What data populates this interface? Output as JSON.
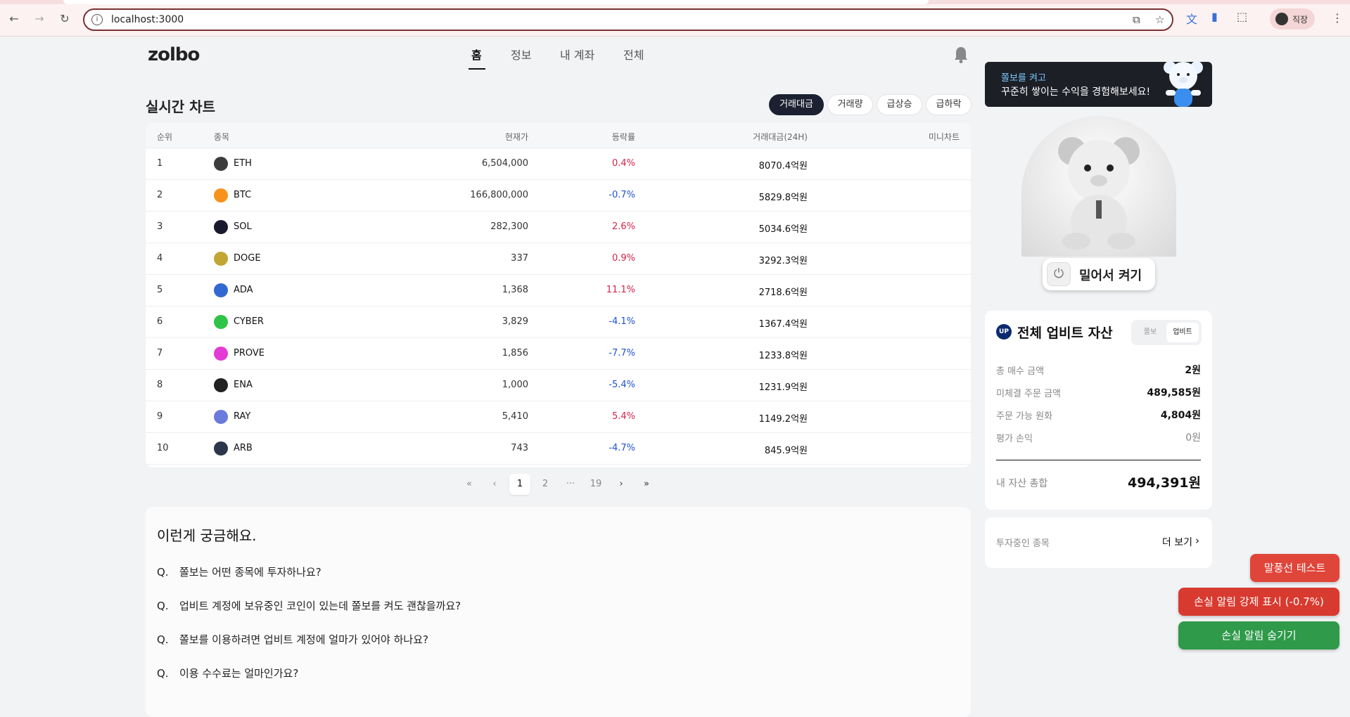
{
  "browser": {
    "url": "localhost:3000",
    "profile_name": "직장"
  },
  "app": {
    "logo": "zolbo",
    "nav": [
      "홈",
      "정보",
      "내 계좌",
      "전체"
    ]
  },
  "chart_section": {
    "title": "실시간 차트",
    "filters": [
      "거래대금",
      "거래량",
      "급상승",
      "급하락"
    ],
    "active_filter": "거래대금",
    "columns": [
      "순위",
      "종목",
      "현재가",
      "등락률",
      "거래대금(24H)",
      "미니차트"
    ],
    "rows": [
      {
        "rank": "1",
        "symbol": "ETH",
        "price": "6,504,000",
        "change": "0.4%",
        "direction": "up",
        "volume": "8070.4억원",
        "icon": "eth-icon",
        "color": "#3c3c3d"
      },
      {
        "rank": "2",
        "symbol": "BTC",
        "price": "166,800,000",
        "change": "-0.7%",
        "direction": "down",
        "volume": "5829.8억원",
        "icon": "btc-icon",
        "color": "#f7931a"
      },
      {
        "rank": "3",
        "symbol": "SOL",
        "price": "282,300",
        "change": "2.6%",
        "direction": "up",
        "volume": "5034.6억원",
        "icon": "sol-icon",
        "color": "#1a1a2e"
      },
      {
        "rank": "4",
        "symbol": "DOGE",
        "price": "337",
        "change": "0.9%",
        "direction": "up",
        "volume": "3292.3억원",
        "icon": "doge-icon",
        "color": "#c2a633"
      },
      {
        "rank": "5",
        "symbol": "ADA",
        "price": "1,368",
        "change": "11.1%",
        "direction": "up",
        "volume": "2718.6억원",
        "icon": "ada-icon",
        "color": "#3468d1"
      },
      {
        "rank": "6",
        "symbol": "CYBER",
        "price": "3,829",
        "change": "-4.1%",
        "direction": "down",
        "volume": "1367.4억원",
        "icon": "cyber-icon",
        "color": "#2ec449"
      },
      {
        "rank": "7",
        "symbol": "PROVE",
        "price": "1,856",
        "change": "-7.7%",
        "direction": "down",
        "volume": "1233.8억원",
        "icon": "prove-icon",
        "color": "#e23bd6"
      },
      {
        "rank": "8",
        "symbol": "ENA",
        "price": "1,000",
        "change": "-5.4%",
        "direction": "down",
        "volume": "1231.9억원",
        "icon": "ena-icon",
        "color": "#222222"
      },
      {
        "rank": "9",
        "symbol": "RAY",
        "price": "5,410",
        "change": "5.4%",
        "direction": "up",
        "volume": "1149.2억원",
        "icon": "ray-icon",
        "color": "#6a7bdc"
      },
      {
        "rank": "10",
        "symbol": "ARB",
        "price": "743",
        "change": "-4.7%",
        "direction": "down",
        "volume": "845.9억원",
        "icon": "arb-icon",
        "color": "#2d374b"
      }
    ]
  },
  "pagination": {
    "first": "«",
    "prev": "‹",
    "pages": [
      "1",
      "2",
      "···",
      "19"
    ],
    "current": "1",
    "next": "›",
    "last": "»"
  },
  "faq": {
    "title": "이런게 궁금해요.",
    "prefix": "Q.",
    "questions": [
      "쫄보는 어떤 종목에 투자하나요?",
      "업비트 계정에 보유중인 코인이 있는데 쫄보를 켜도 괜찮을까요?",
      "쫄보를 이용하려면 업비트 계정에 얼마가 있어야 하나요?",
      "이용 수수료는 얼마인가요?"
    ]
  },
  "banner": {
    "line1": "쫄보를 켜고",
    "line2": "꾸준히 쌓이는 수익을 경험해보세요!"
  },
  "power": {
    "label": "밀어서 켜기"
  },
  "assets": {
    "title": "전체 업비트 자산",
    "tabs": [
      "쫄보",
      "업비트"
    ],
    "active_tab": "업비트",
    "items": [
      {
        "label": "총 매수 금액",
        "value": "2원"
      },
      {
        "label": "미체결 주문 금액",
        "value": "489,585원"
      },
      {
        "label": "주문 가능 원화",
        "value": "4,804원"
      },
      {
        "label": "평가 손익",
        "value": "0원"
      }
    ],
    "total_label": "내 자산 총합",
    "total_value": "494,391원"
  },
  "holdings": {
    "label": "투자중인 종목",
    "more": "더 보기"
  },
  "floating_buttons": [
    {
      "label": "말풍선 테스트",
      "color": "#e0453a"
    },
    {
      "label": "손실 알림 강제 표시 (-0.7%)",
      "color": "#d93a2f"
    },
    {
      "label": "손실 알림 숨기기",
      "color": "#2e9a4a"
    }
  ]
}
